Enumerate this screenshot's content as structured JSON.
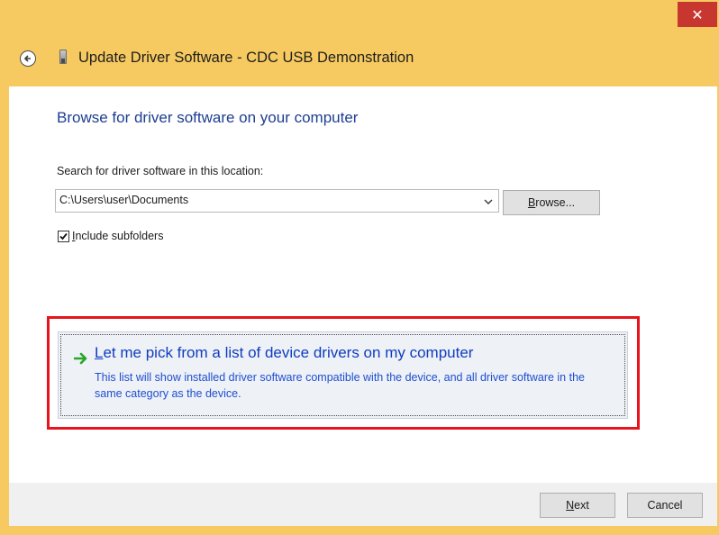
{
  "window": {
    "title": "Update Driver Software - CDC USB Demonstration",
    "close_glyph": "✕",
    "accent_color": "#f6ca60"
  },
  "header": {
    "title": "Update Driver Software - CDC USB Demonstration",
    "back_icon": "back-arrow-icon",
    "device_icon": "usb-device-icon"
  },
  "main": {
    "heading": "Browse for driver software on your computer",
    "search_label": "Search for driver software in this location:",
    "path_value": "C:\\Users\\user\\Documents",
    "browse_label": "Browse...",
    "include_subfolders_label": "Include subfolders",
    "include_subfolders_checked": true,
    "command_link": {
      "title": "Let me pick from a list of device drivers on my computer",
      "description": "This list will show installed driver software compatible with the device, and all driver software in the same category as the device.",
      "icon": "green-arrow-icon"
    },
    "highlight_color": "#e8141b"
  },
  "footer": {
    "next_label": "Next",
    "cancel_label": "Cancel"
  }
}
